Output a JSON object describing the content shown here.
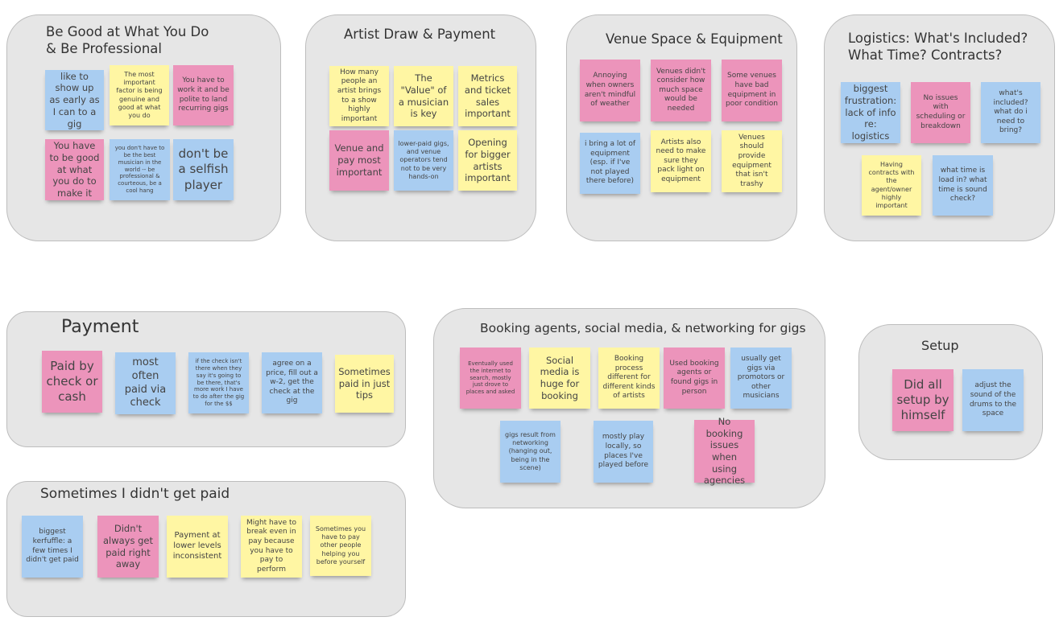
{
  "groups": {
    "be_good": {
      "title": "Be Good at What You Do\n& Be Professional",
      "notes": [
        "like to show up as early as I can to a gig",
        "The most important factor is being genuine and good at what you do",
        "You have to work it and be polite to land recurring gigs",
        "You have to be good at what you do to make it",
        "you don't have to be the best musician in the world -- be professional & courteous, be a cool hang",
        "don't be a selfish player"
      ]
    },
    "artist_draw": {
      "title": "Artist Draw & Payment",
      "notes": [
        "How many people an artist brings to a show highly important",
        "The \"Value\" of a musician is key",
        "Metrics and ticket sales important",
        "Venue and pay most important",
        "lower-paid gigs, and venue operators tend not to be very hands-on",
        "Opening for bigger artists important"
      ]
    },
    "venue_space": {
      "title": "Venue Space & Equipment",
      "notes": [
        "Annoying when owners aren't mindful of weather",
        "Venues didn't consider how much space would be needed",
        "Some venues have bad equipment in poor condition",
        "i bring a lot of equipment (esp. if I've not played there before)",
        "Artists also need to make sure they pack light on equipment",
        "Venues should provide equipment that isn't trashy"
      ]
    },
    "logistics": {
      "title": "Logistics: What's Included?\nWhat Time? Contracts?",
      "notes": [
        "biggest frustration: lack of info re: logistics",
        "No issues with scheduling or breakdown",
        "what's included? what do i need to bring?",
        "Having contracts with the agent/owner highly important",
        "what time is load in? what time is sound check?"
      ]
    },
    "payment": {
      "title": "Payment",
      "notes": [
        "Paid by check or cash",
        "most often paid via check",
        "if the check isn't there when they say it's going to be there, that's more work I have to do after the gig for the $$",
        "agree on a price, fill out a w-2, get the check at the gig",
        "Sometimes paid in just tips"
      ]
    },
    "booking": {
      "title": "Booking agents, social media, & networking for gigs",
      "notes": [
        "Eventually used the internet to search, mostly just drove to places and asked",
        "Social media is huge for booking",
        "Booking process different for different kinds of artists",
        "Used booking agents or found gigs in person",
        "usually get gigs via promotors or other musicians",
        "gigs result from networking (hanging out, being in the scene)",
        "mostly play locally, so places I've played before",
        "No booking issues when using agencies"
      ]
    },
    "setup": {
      "title": "Setup",
      "notes": [
        "Did all setup by himself",
        "adjust the sound of the drums to the space"
      ]
    },
    "not_paid": {
      "title": "Sometimes I didn't get paid",
      "notes": [
        "biggest kerfuffle: a few times I didn't get paid",
        "Didn't always get paid right away",
        "Payment at lower levels inconsistent",
        "Might have to break even in pay because you have to pay to perform",
        "Sometimes you have to pay other people helping you before yourself"
      ]
    }
  },
  "colors": {
    "pink": "#ec94bb",
    "blue": "#a9cdf1",
    "yellow": "#fff6a3",
    "group_bg": "#e6e6e6"
  }
}
